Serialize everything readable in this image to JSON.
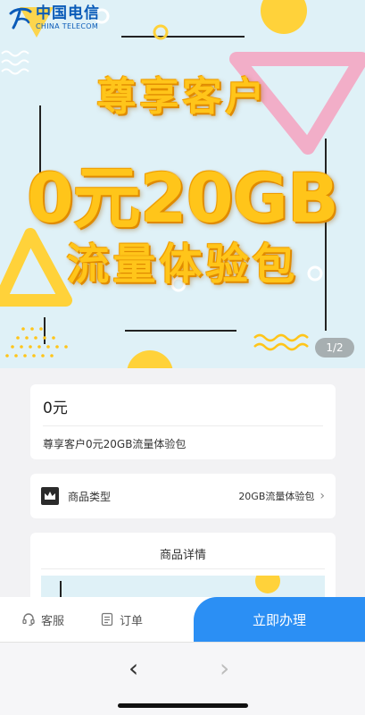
{
  "brand": {
    "name_cn": "中国电信",
    "name_en": "CHINA TELECOM",
    "color": "#0a5bb8"
  },
  "banner": {
    "line1": "尊享客户",
    "line2": "0元20GB",
    "line3": "流量体验包",
    "counter": "1/2",
    "text_color": "#ffc51a"
  },
  "product": {
    "price": "0元",
    "title": "尊享客户0元20GB流量体验包"
  },
  "type_row": {
    "label": "商品类型",
    "value": "20GB流量体验包"
  },
  "details": {
    "title": "商品详情"
  },
  "actions": {
    "service": "客服",
    "order": "订单",
    "apply": "立即办理",
    "apply_color": "#2b8ff4"
  },
  "browser": {
    "back": "‹",
    "forward": "›"
  }
}
